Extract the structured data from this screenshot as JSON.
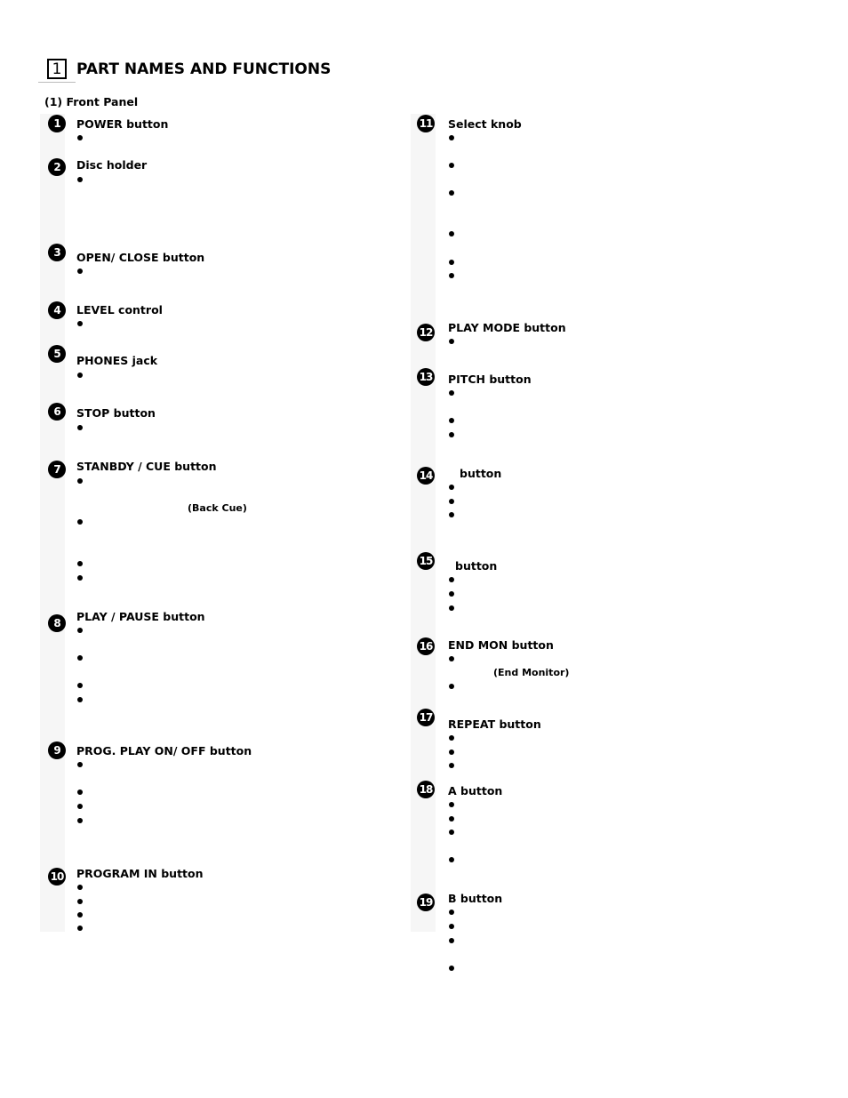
{
  "section": {
    "number": "1",
    "title": "PART NAMES AND FUNCTIONS",
    "subsection": "(1) Front Panel"
  },
  "items": [
    {
      "number": "1",
      "label": "POWER button"
    },
    {
      "number": "2",
      "label": "Disc holder"
    },
    {
      "number": "3",
      "label": "OPEN/ CLOSE button"
    },
    {
      "number": "4",
      "label": "LEVEL control"
    },
    {
      "number": "5",
      "label": "PHONES jack"
    },
    {
      "number": "6",
      "label": "STOP button"
    },
    {
      "number": "7",
      "label": "STANBDY / CUE button",
      "note": "(Back Cue)"
    },
    {
      "number": "8",
      "label": "PLAY / PAUSE button"
    },
    {
      "number": "9",
      "label": "PROG. PLAY ON/ OFF button"
    },
    {
      "number": "10",
      "label": "PROGRAM IN button"
    },
    {
      "number": "11",
      "label": "Select knob"
    },
    {
      "number": "12",
      "label": "PLAY MODE button"
    },
    {
      "number": "13",
      "label": "PITCH button"
    },
    {
      "number": "14",
      "label": "button"
    },
    {
      "number": "15",
      "label": "button"
    },
    {
      "number": "16",
      "label": "END MON button",
      "note": "(End Monitor)"
    },
    {
      "number": "17",
      "label": "REPEAT button"
    },
    {
      "number": "18",
      "label": "A button"
    },
    {
      "number": "19",
      "label": "B button"
    }
  ]
}
